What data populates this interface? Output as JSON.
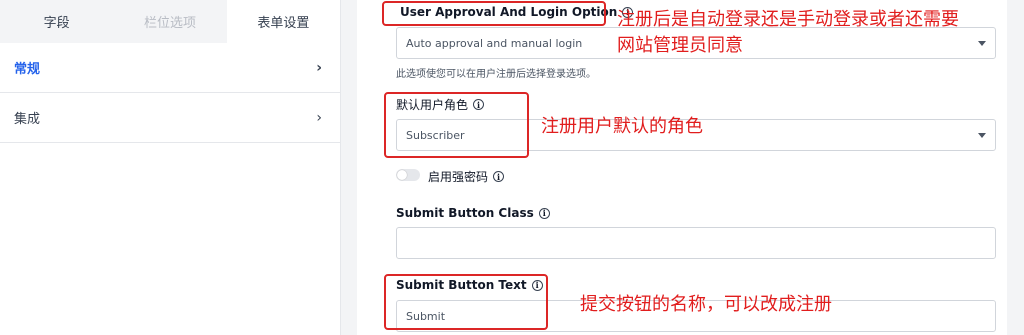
{
  "sidebar": {
    "tabs": [
      {
        "label": "字段"
      },
      {
        "label": "栏位选项"
      },
      {
        "label": "表单设置"
      }
    ],
    "items": [
      {
        "label": "常规"
      },
      {
        "label": "集成"
      }
    ]
  },
  "form": {
    "approval": {
      "label": "User Approval And Login Option",
      "value": "Auto approval and manual login",
      "help": "此选项使您可以在用户注册后选择登录选项。"
    },
    "default_role": {
      "label": "默认用户角色",
      "value": "Subscriber"
    },
    "strong_password": {
      "label": "启用强密码"
    },
    "submit_class": {
      "label": "Submit Button Class",
      "value": ""
    },
    "submit_text": {
      "label": "Submit Button Text",
      "value": "Submit"
    }
  },
  "annotations": {
    "approval_note_line1": "注册后是自动登录还是手动登录或者还需要",
    "approval_note_line2": "网站管理员同意",
    "role_note": "注册用户默认的角色",
    "submit_note": "提交按钮的名称，可以改成注册"
  },
  "colors": {
    "accent": "#2563eb",
    "annotation": "#e11d1d"
  }
}
